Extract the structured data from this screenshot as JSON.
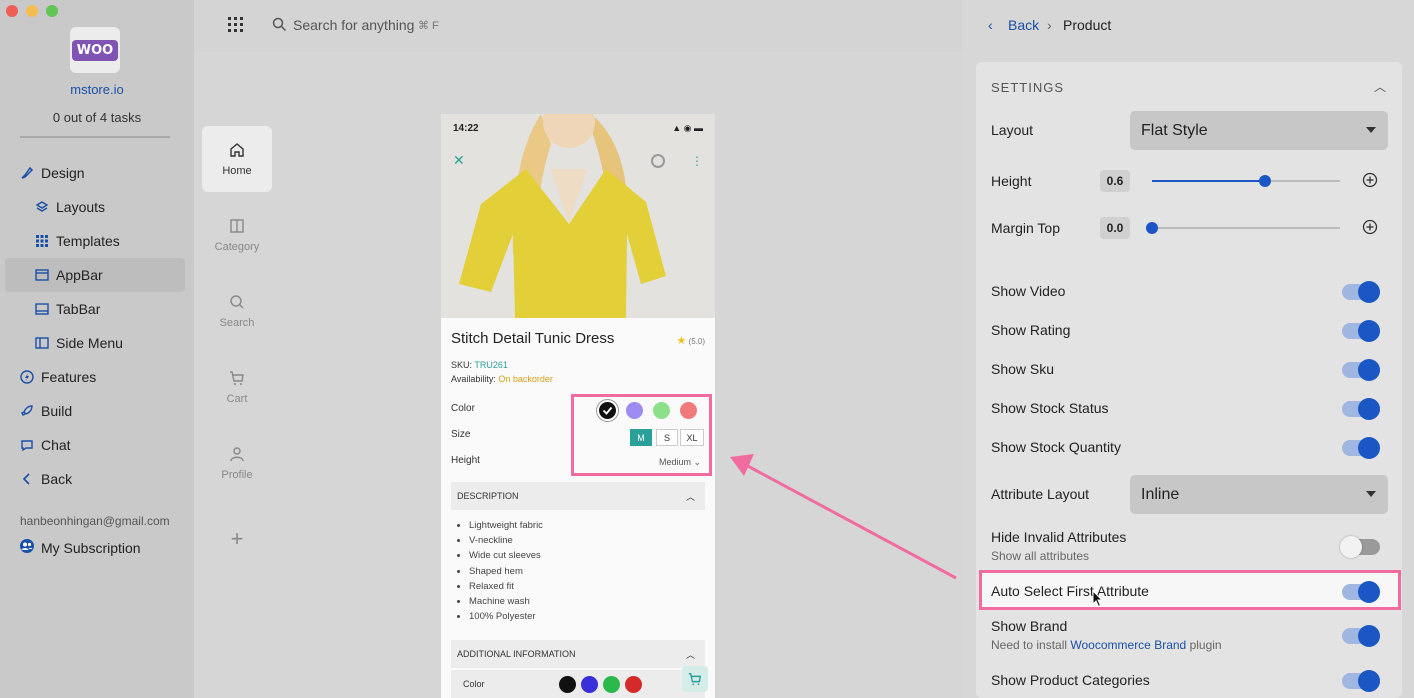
{
  "sidebar": {
    "store_name": "mstore.io",
    "logo_text": "WOO",
    "tasks": "0 out of 4 tasks",
    "items": [
      {
        "label": "Design"
      },
      {
        "label": "Layouts"
      },
      {
        "label": "Templates"
      },
      {
        "label": "AppBar"
      },
      {
        "label": "TabBar"
      },
      {
        "label": "Side Menu"
      },
      {
        "label": "Features"
      },
      {
        "label": "Build"
      },
      {
        "label": "Chat"
      },
      {
        "label": "Back"
      }
    ],
    "email": "hanbeonhingan@gmail.com",
    "subscription": "My Subscription"
  },
  "topbar": {
    "search_placeholder": "Search for anything",
    "search_shortcut": "⌘ F"
  },
  "tabrail": {
    "tabs": [
      {
        "label": "Home"
      },
      {
        "label": "Category"
      },
      {
        "label": "Search"
      },
      {
        "label": "Cart"
      },
      {
        "label": "Profile"
      }
    ],
    "add": "+"
  },
  "phone": {
    "time": "14:22",
    "title": "Stitch Detail Tunic Dress",
    "rating": "(5.0)",
    "sku_label": "SKU:",
    "sku_value": "TRU261",
    "avail_label": "Availability:",
    "avail_value": "On backorder",
    "color_label": "Color",
    "size_label": "Size",
    "height_label": "Height",
    "sizes": [
      "M",
      "S",
      "XL"
    ],
    "height_value": "Medium",
    "description_title": "DESCRIPTION",
    "description_items": [
      "Lightweight fabric",
      "V-neckline",
      "Wide cut sleeves",
      "Shaped hem",
      "Relaxed fit",
      "Machine wash",
      "100% Polyester"
    ],
    "additional_title": "ADDITIONAL INFORMATION",
    "additional_color_label": "Color",
    "swatch_colors": [
      "#111111",
      "#9f8cf2",
      "#8de08a",
      "#f07a7a"
    ],
    "additional_swatches": [
      "#111111",
      "#3a2fd8",
      "#2cb84a",
      "#d42a2a"
    ],
    "accent": "#2aa198"
  },
  "rightpanel": {
    "back": "Back",
    "crumb": "Product",
    "section_title": "SETTINGS",
    "layout_label": "Layout",
    "layout_value": "Flat Style",
    "height_label": "Height",
    "height_value": "0.6",
    "height_level": 0.6,
    "margin_label": "Margin Top",
    "margin_value": "0.0",
    "margin_level": 0.0,
    "toggles": [
      {
        "label": "Show Video",
        "on": true
      },
      {
        "label": "Show Rating",
        "on": true
      },
      {
        "label": "Show Sku",
        "on": true
      },
      {
        "label": "Show Stock Status",
        "on": true
      },
      {
        "label": "Show Stock Quantity",
        "on": true
      }
    ],
    "attr_layout_label": "Attribute Layout",
    "attr_layout_value": "Inline",
    "hide_invalid_label": "Hide Invalid Attributes",
    "hide_invalid_hint": "Show all attributes",
    "auto_select_label": "Auto Select First Attribute",
    "show_brand_label": "Show Brand",
    "brand_hint_pre": "Need to install",
    "brand_hint_link": "Woocommerce Brand",
    "brand_hint_post": "plugin",
    "categories_label": "Show Product Categories",
    "accent": "#1a56c4",
    "highlight": "#f06ca0"
  }
}
